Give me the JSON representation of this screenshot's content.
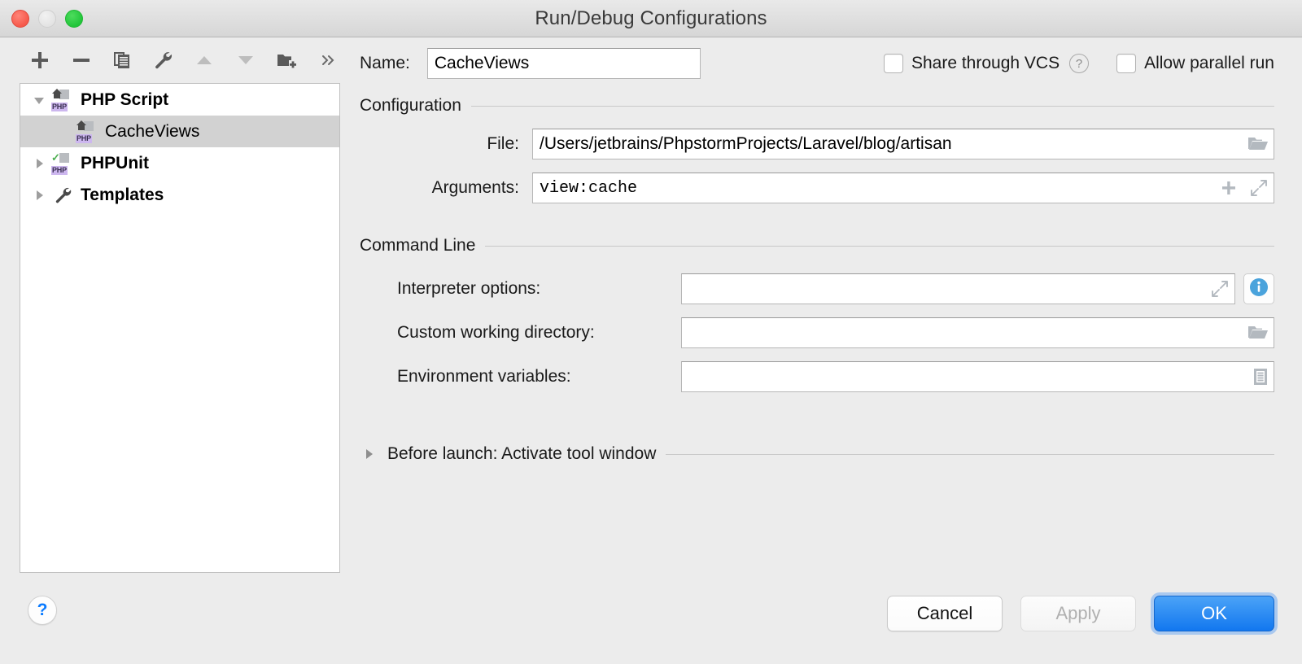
{
  "window": {
    "title": "Run/Debug Configurations",
    "traffic_lights": [
      "close",
      "minimize",
      "zoom"
    ]
  },
  "toolbar": {
    "buttons": [
      {
        "name": "add-button",
        "icon": "plus-icon",
        "enabled": true
      },
      {
        "name": "remove-button",
        "icon": "minus-icon",
        "enabled": true
      },
      {
        "name": "copy-configuration-button",
        "icon": "copy-icon",
        "enabled": true
      },
      {
        "name": "edit-templates-button",
        "icon": "wrench-icon",
        "enabled": true
      },
      {
        "name": "move-up-button",
        "icon": "arrow-up-icon",
        "enabled": false
      },
      {
        "name": "move-down-button",
        "icon": "arrow-down-icon",
        "enabled": false
      },
      {
        "name": "create-folder-button",
        "icon": "new-folder-icon",
        "enabled": true
      },
      {
        "name": "more-options-button",
        "icon": "double-chevron-right-icon",
        "enabled": true
      }
    ]
  },
  "tree": {
    "nodes": [
      {
        "label": "PHP Script",
        "icon": "php-script-icon",
        "expanded": true,
        "bold": true,
        "selected": false,
        "level": 0
      },
      {
        "label": "CacheViews",
        "icon": "php-script-icon",
        "expanded": null,
        "bold": false,
        "selected": true,
        "level": 1
      },
      {
        "label": "PHPUnit",
        "icon": "phpunit-icon",
        "expanded": false,
        "bold": true,
        "selected": false,
        "level": 0
      },
      {
        "label": "Templates",
        "icon": "wrench-icon",
        "expanded": false,
        "bold": true,
        "selected": false,
        "level": 0
      }
    ]
  },
  "help": {
    "label": "?"
  },
  "header": {
    "name_label": "Name:",
    "name_value": "CacheViews",
    "name_placeholder": "",
    "share_vcs_label": "Share through VCS",
    "share_vcs_checked": false,
    "share_vcs_help": "?",
    "allow_parallel_label": "Allow parallel run",
    "allow_parallel_checked": false
  },
  "configuration": {
    "group_title": "Configuration",
    "file_label": "File:",
    "file_value": "/Users/jetbrains/PhpstormProjects/Laravel/blog/artisan",
    "file_placeholder": "",
    "file_icon": "folder-browse-icon",
    "arguments_label": "Arguments:",
    "arguments_value": "view:cache",
    "arguments_placeholder": "",
    "arguments_add_icon": "plus-icon",
    "arguments_expand_icon": "expand-icon"
  },
  "command_line": {
    "group_title": "Command Line",
    "rows": [
      {
        "label": "Interpreter options:",
        "value": "",
        "placeholder": "",
        "field_icon": "expand-icon",
        "side_button": "info-icon"
      },
      {
        "label": "Custom working directory:",
        "value": "",
        "placeholder": "",
        "field_icon": "folder-browse-icon",
        "side_button": ""
      },
      {
        "label": "Environment variables:",
        "value": "",
        "placeholder": "",
        "field_icon": "list-edit-icon",
        "side_button": ""
      }
    ]
  },
  "before_launch": {
    "title": "Before launch: Activate tool window",
    "expanded": false,
    "twisty_icon": "triangle-right-icon"
  },
  "footer": {
    "cancel_label": "Cancel",
    "apply_label": "Apply",
    "apply_enabled": false,
    "ok_label": "OK",
    "ok_default": true
  },
  "colors": {
    "window_bg": "#ececec",
    "panel_bg": "#ffffff",
    "selection_bg": "#d2d2d2",
    "accent_blue": "#1277ef",
    "info_blue": "#4aa3dc",
    "php_badge": "#cdb7ef",
    "border": "#c0c0c0"
  }
}
